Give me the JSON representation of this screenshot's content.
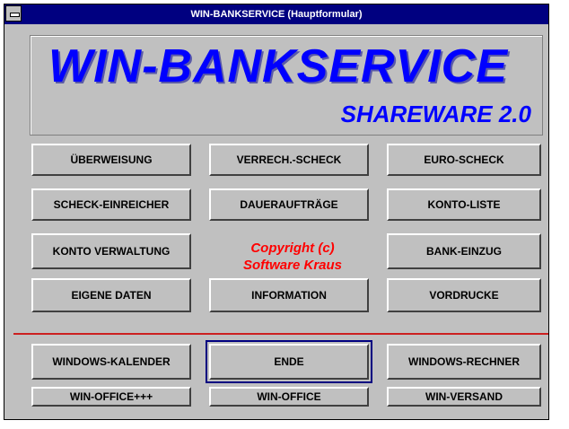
{
  "window": {
    "title": "WIN-BANKSERVICE (Hauptformular)"
  },
  "banner": {
    "title": "WIN-BANKSERVICE",
    "subtitle": "SHAREWARE 2.0"
  },
  "buttons": {
    "ueberweisung": "ÜBERWEISUNG",
    "verrech_scheck": "VERRECH.-SCHECK",
    "euro_scheck": "EURO-SCHECK",
    "scheck_einreicher": "SCHECK-EINREICHER",
    "dauerauftraege": "DAUERAUFTRÄGE",
    "konto_liste": "KONTO-LISTE",
    "konto_verwaltung": "KONTO VERWALTUNG",
    "bank_einzug": "BANK-EINZUG",
    "eigene_daten": "EIGENE DATEN",
    "information": "INFORMATION",
    "vordrucke": "VORDRUCKE",
    "windows_kalender": "WINDOWS-KALENDER",
    "ende": "ENDE",
    "windows_rechner": "WINDOWS-RECHNER",
    "win_office_plus": "WIN-OFFICE+++",
    "win_office": "WIN-OFFICE",
    "win_versand": "WIN-VERSAND"
  },
  "copyright": {
    "line1": "Copyright (c)",
    "line2": "Software Kraus"
  },
  "colors": {
    "title_bar": "#000080",
    "banner_text": "#0000ff",
    "copyright": "#ff0000",
    "divider": "#cc2020"
  }
}
